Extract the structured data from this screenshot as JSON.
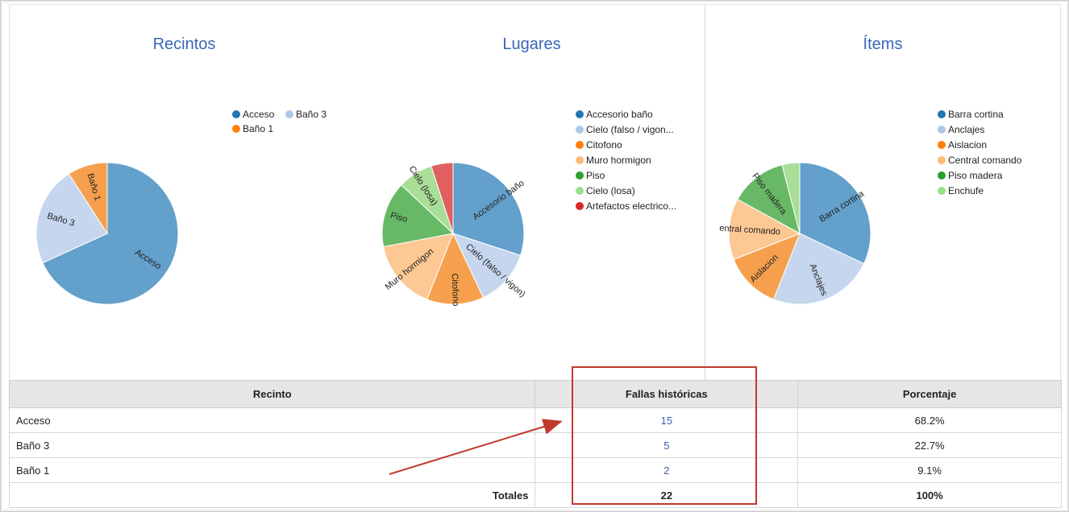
{
  "charts": {
    "recintos": {
      "title": "Recintos"
    },
    "lugares": {
      "title": "Lugares"
    },
    "items": {
      "title": "Ítems"
    }
  },
  "chart_data": [
    {
      "type": "pie",
      "title": "Recintos",
      "categories": [
        "Acceso",
        "Baño 3",
        "Baño 1"
      ],
      "values": [
        15,
        5,
        2
      ],
      "colors": [
        "#63a0cb",
        "#c6d6ee",
        "#f6a04d"
      ],
      "legend": "top-right"
    },
    {
      "type": "pie",
      "title": "Lugares",
      "categories": [
        "Accesorio baño",
        "Cielo (falso / vigon)",
        "Citofono",
        "Muro hormigon",
        "Piso",
        "Cielo (losa)",
        "Artefactos electricos"
      ],
      "legend_labels": [
        "Accesorio baño",
        "Cielo (falso / vigon...",
        "Citofono",
        "Muro hormigon",
        "Piso",
        "Cielo (losa)",
        "Artefactos electrico..."
      ],
      "values": [
        30,
        13,
        13,
        16,
        15,
        8,
        5
      ],
      "colors": [
        "#63a0cb",
        "#c6d6ee",
        "#f6a04d",
        "#fdc894",
        "#68b966",
        "#a8de97",
        "#e0605f"
      ],
      "legend": "top-right"
    },
    {
      "type": "pie",
      "title": "Ítems",
      "categories": [
        "Barra cortina",
        "Anclajes",
        "Aislacion",
        "Central comando",
        "Piso madera",
        "Enchufe"
      ],
      "values": [
        32,
        24,
        13,
        14,
        13,
        4
      ],
      "colors": [
        "#63a0cb",
        "#c6d6ee",
        "#f6a04d",
        "#fdc894",
        "#68b966",
        "#a8de97"
      ],
      "legend": "top-right"
    }
  ],
  "legends": {
    "recintos": [
      {
        "label": "Acceso",
        "color": "#1f77b4"
      },
      {
        "label": "Baño 3",
        "color": "#aec7e8"
      },
      {
        "label": "Baño 1",
        "color": "#ff7f0e"
      }
    ],
    "lugares": [
      {
        "label": "Accesorio baño",
        "color": "#1f77b4"
      },
      {
        "label": "Cielo (falso / vigon...",
        "color": "#aec7e8"
      },
      {
        "label": "Citofono",
        "color": "#ff7f0e"
      },
      {
        "label": "Muro hormigon",
        "color": "#ffbb78"
      },
      {
        "label": "Piso",
        "color": "#2ca02c"
      },
      {
        "label": "Cielo (losa)",
        "color": "#98df8a"
      },
      {
        "label": "Artefactos electrico...",
        "color": "#d62728"
      }
    ],
    "items": [
      {
        "label": "Barra cortina",
        "color": "#1f77b4"
      },
      {
        "label": "Anclajes",
        "color": "#aec7e8"
      },
      {
        "label": "Aislacion",
        "color": "#ff7f0e"
      },
      {
        "label": "Central comando",
        "color": "#ffbb78"
      },
      {
        "label": "Piso madera",
        "color": "#2ca02c"
      },
      {
        "label": "Enchufe",
        "color": "#98df8a"
      }
    ]
  },
  "slice_labels": {
    "recintos": [
      "Acceso",
      "Baño 3",
      "Baño 1"
    ],
    "lugares": [
      "Accesorio baño",
      "Cielo (falso / vigon)",
      "Citofono",
      "Muro hormigon",
      "Piso",
      "Cielo (losa)"
    ],
    "items": [
      "Barra cortina",
      "Anclajes",
      "Aislacion",
      "entral comando",
      "Piso madera"
    ]
  },
  "table": {
    "headers": [
      "Recinto",
      "Fallas históricas",
      "Porcentaje"
    ],
    "rows": [
      {
        "recinto": "Acceso",
        "fallas": "15",
        "porcentaje": "68.2%"
      },
      {
        "recinto": "Baño 3",
        "fallas": "5",
        "porcentaje": "22.7%"
      },
      {
        "recinto": "Baño 1",
        "fallas": "2",
        "porcentaje": "9.1%"
      }
    ],
    "totals": {
      "label": "Totales",
      "fallas": "22",
      "porcentaje": "100%"
    }
  },
  "annotation": {
    "highlight_color": "#c0392b"
  }
}
